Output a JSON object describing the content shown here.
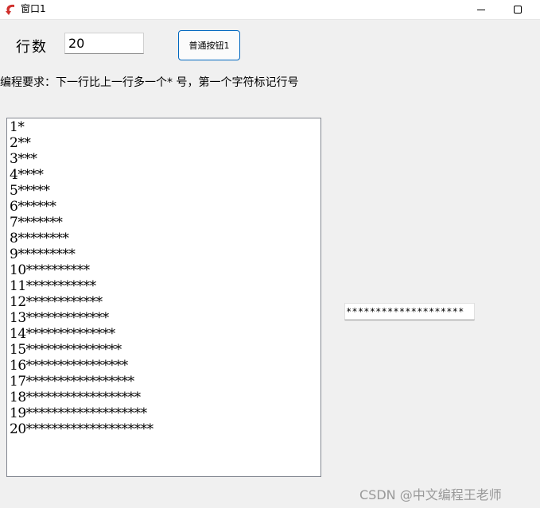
{
  "window": {
    "title": "窗口1",
    "icon": "app-arrow-icon",
    "minimize_icon": "minimize-icon",
    "maximize_icon": "maximize-icon"
  },
  "form": {
    "row_label": "行数",
    "row_value": "20",
    "button_label": "普通按钮1",
    "requirement": "编程要求：下一行比上一行多一个* 号，第一个字符标记行号"
  },
  "output_lines": [
    "1*",
    "2**",
    "3***",
    "4****",
    "5*****",
    "6******",
    "7*******",
    "8********",
    "9*********",
    "10**********",
    "11***********",
    "12************",
    "13*************",
    "14**************",
    "15***************",
    "16****************",
    "17*****************",
    "18******************",
    "19*******************",
    "20********************"
  ],
  "side_field_value": "********************",
  "watermark": "CSDN @中文编程王老师",
  "colors": {
    "background": "#f0f0f0",
    "button_border": "#0067c0",
    "icon_red": "#d0312d",
    "watermark": "#999999"
  }
}
